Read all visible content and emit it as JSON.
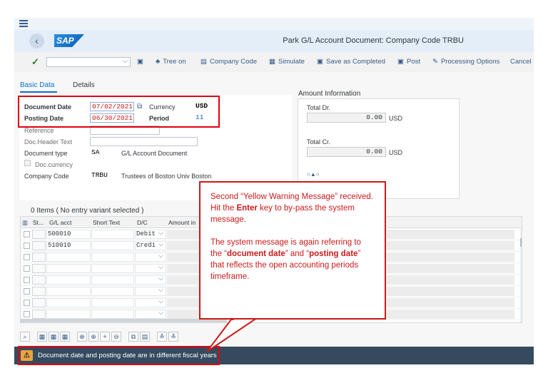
{
  "app": {
    "title": "Park G/L Account Document: Company Code TRBU",
    "logo_text": "SAP"
  },
  "toolbar": {
    "tree_on": "Tree on",
    "company_code": "Company Code",
    "simulate": "Simulate",
    "save_as_completed": "Save as Completed",
    "post": "Post",
    "processing_options": "Processing Options",
    "cancel": "Cancel"
  },
  "tabs": {
    "basic_data": "Basic Data",
    "details": "Details"
  },
  "basic_data": {
    "document_date_label": "Document Date",
    "document_date_value": "07/02/2021",
    "currency_label": "Currency",
    "currency_value": "USD",
    "posting_date_label": "Posting Date",
    "posting_date_value": "06/30/2021",
    "period_label": "Period",
    "period_value": "11",
    "reference_label": "Reference",
    "doc_header_label": "Doc.Header Text",
    "document_type_label": "Document type",
    "document_type_value": "SA",
    "document_type_desc": "G/L Account Document",
    "doc_currency_label": "Doc.currency",
    "company_code_label": "Company Code",
    "company_code_value": "TRBU",
    "company_code_desc": "Trustees of Boston Univ Boston"
  },
  "amount_info": {
    "title": "Amount Information",
    "total_dr_label": "Total Dr.",
    "total_dr_value": "0.00",
    "total_dr_currency": "USD",
    "total_cr_label": "Total Cr.",
    "total_cr_value": "0.00",
    "total_cr_currency": "USD"
  },
  "items": {
    "title": "0 Items ( No entry variant selected )",
    "columns": [
      "St...",
      "G/L acct",
      "Short Text",
      "D/C",
      "Amount in"
    ],
    "rows": [
      {
        "gl_acct": "500010",
        "dc": "Debit"
      },
      {
        "gl_acct": "510010",
        "dc": "Credi"
      },
      {
        "gl_acct": "",
        "dc": ""
      },
      {
        "gl_acct": "",
        "dc": ""
      },
      {
        "gl_acct": "",
        "dc": ""
      },
      {
        "gl_acct": "",
        "dc": ""
      },
      {
        "gl_acct": "",
        "dc": ""
      },
      {
        "gl_acct": "",
        "dc": ""
      }
    ]
  },
  "status": {
    "message": "Document date and posting date are in different fiscal years",
    "type": "warning"
  },
  "callout": {
    "p1_a": "Second “Yellow Warning Message” received. Hit the ",
    "p1_bold": "Enter",
    "p1_b": " key to by-pass the system message.",
    "p2_a": "The system message is again referring to the “",
    "p2_bold1": "document date",
    "p2_b": "” and “",
    "p2_bold2": "posting date",
    "p2_c": "” that reflects the open accounting periods timeframe."
  },
  "colors": {
    "accent": "#0a6ed1",
    "warning": "#e9a53c",
    "annotation_red": "#cc1919",
    "statusbar": "#354a5f"
  }
}
